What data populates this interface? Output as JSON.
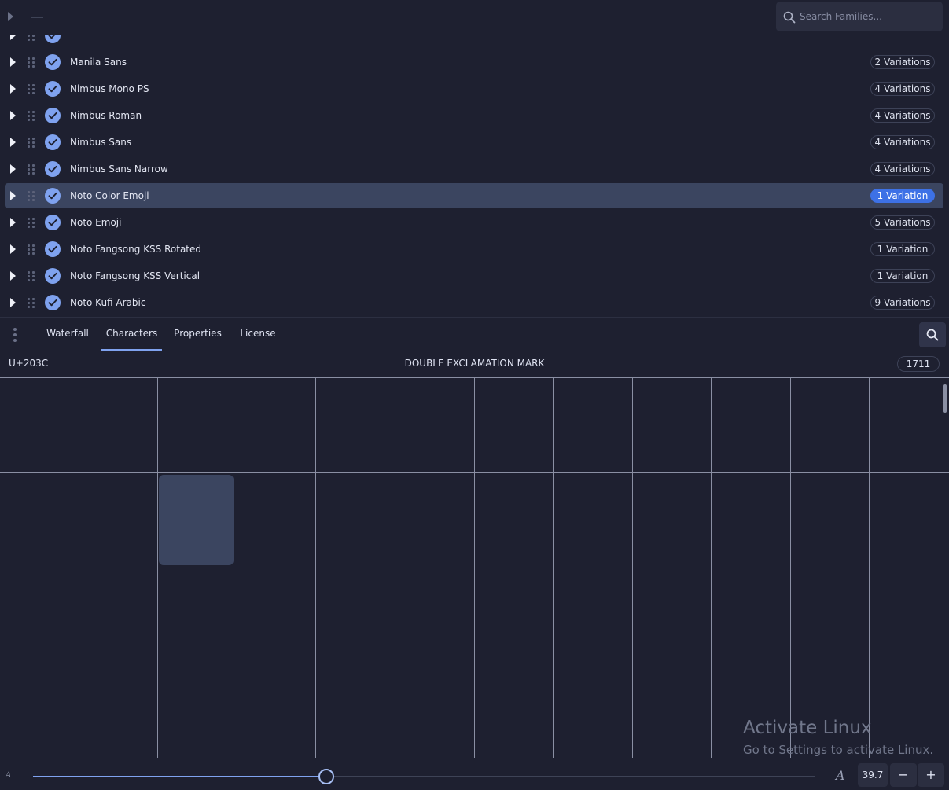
{
  "search": {
    "placeholder": "Search Families..."
  },
  "families": [
    {
      "name": "",
      "badge": "",
      "partial": true
    },
    {
      "name": "Manila Sans",
      "badge": "2 Variations"
    },
    {
      "name": "Nimbus Mono PS",
      "badge": "4 Variations"
    },
    {
      "name": "Nimbus Roman",
      "badge": "4 Variations"
    },
    {
      "name": "Nimbus Sans",
      "badge": "4 Variations"
    },
    {
      "name": "Nimbus Sans Narrow",
      "badge": "4 Variations"
    },
    {
      "name": "Noto Color Emoji",
      "badge": "1 Variation",
      "selected": true
    },
    {
      "name": "Noto Emoji",
      "badge": "5 Variations"
    },
    {
      "name": "Noto Fangsong KSS Rotated",
      "badge": "1 Variation"
    },
    {
      "name": "Noto Fangsong KSS Vertical",
      "badge": "1 Variation"
    },
    {
      "name": "Noto Kufi Arabic",
      "badge": "9 Variations"
    }
  ],
  "tabs": [
    {
      "id": "waterfall",
      "label": "Waterfall",
      "active": false
    },
    {
      "id": "characters",
      "label": "Characters",
      "active": true
    },
    {
      "id": "properties",
      "label": "Properties",
      "active": false
    },
    {
      "id": "license",
      "label": "License",
      "active": false
    }
  ],
  "glyph_info": {
    "codepoint": "U+203C",
    "name": "DOUBLE EXCLAMATION MARK",
    "count": "1711"
  },
  "glyph_grid": {
    "columns": 12,
    "visible_rows": 4,
    "selected_row": 1,
    "selected_col": 2
  },
  "watermark": {
    "title": "Activate Linux",
    "subtitle": "Go to Settings to activate Linux."
  },
  "preview_size": {
    "value": "39.7",
    "slider_fraction": 0.375,
    "decrease_label": "−",
    "increase_label": "+",
    "small_glyph": "A",
    "large_glyph": "A"
  },
  "colors": {
    "background": "#1e2030",
    "accent": "#7fa2ef",
    "selected_row": "#3b4560",
    "selected_badge": "#3d71e6"
  },
  "icons": {
    "expand": "triangle-right-icon",
    "drag": "drag-handle-icon",
    "check": "check-circle-icon",
    "search": "search-icon",
    "menu": "vertical-dots-icon"
  }
}
